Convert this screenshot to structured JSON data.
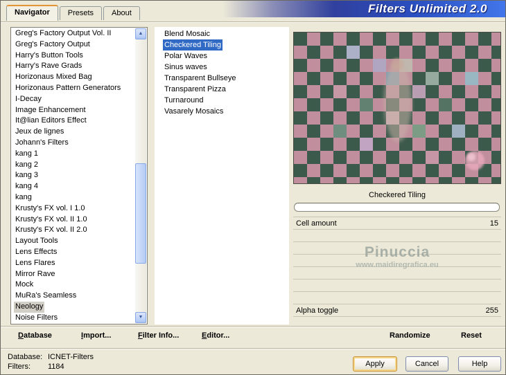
{
  "window": {
    "title": "Filters Unlimited 2.0"
  },
  "tabs": {
    "items": [
      {
        "label": "Navigator",
        "active": true
      },
      {
        "label": "Presets",
        "active": false
      },
      {
        "label": "About",
        "active": false
      }
    ]
  },
  "categories": {
    "items": [
      "Greg's Factory Output Vol. II",
      "Greg's Factory Output",
      "Harry's Button Tools",
      "Harry's Rave Grads",
      "Horizonaus Mixed Bag",
      "Horizonaus Pattern Generators",
      "I-Decay",
      "Image Enhancement",
      "It@lian Editors Effect",
      "Jeux de lignes",
      "Johann's Filters",
      "kang 1",
      "kang 2",
      "kang 3",
      "kang 4",
      "kang",
      "Krusty's FX vol. I 1.0",
      "Krusty's FX vol. II 1.0",
      "Krusty's FX vol. II 2.0",
      "Layout Tools",
      "Lens Effects",
      "Lens Flares",
      "Mirror Rave",
      "Mock",
      "MuRa's Seamless",
      "Neology",
      "Noise Filters"
    ],
    "selected": "Neology"
  },
  "filters": {
    "items": [
      "Blend Mosaic",
      "Checkered Tiling",
      "Polar Waves",
      "Sinus waves",
      "Transparent Bullseye",
      "Transparent Pizza",
      "Turnaround",
      "Vasarely Mosaics"
    ],
    "selected": "Checkered Tiling"
  },
  "preview": {
    "title": "Checkered Tiling",
    "watermark_line1": "Pinuccia",
    "watermark_line2": "www.maidiregrafica.eu"
  },
  "parameters": {
    "rows": [
      {
        "label": "Cell amount",
        "value": "15"
      },
      {},
      {},
      {},
      {},
      {},
      {},
      {
        "label": "Alpha toggle",
        "value": "255"
      }
    ]
  },
  "toolbar": {
    "database": "Database",
    "import_label": "Import...",
    "filter_info": "Filter Info...",
    "editor": "Editor...",
    "randomize": "Randomize",
    "reset": "Reset"
  },
  "statusbar": {
    "database_label": "Database:",
    "database_value": "ICNET-Filters",
    "filters_label": "Filters:",
    "filters_value": "1184"
  },
  "buttons": {
    "apply": "Apply",
    "cancel": "Cancel",
    "help": "Help"
  },
  "icons": {
    "scroll_up": "▲",
    "scroll_down": "▼"
  },
  "colors": {
    "selection_blue": "#316ac5",
    "inactive_selection": "#d2cfc6",
    "header_blue_dark": "#2a3a9e",
    "header_blue_bright": "#4276ea",
    "checker_pink": "#c08e9c",
    "checker_green": "#3c5a4c",
    "apply_focus_ring": "#f6d688"
  }
}
